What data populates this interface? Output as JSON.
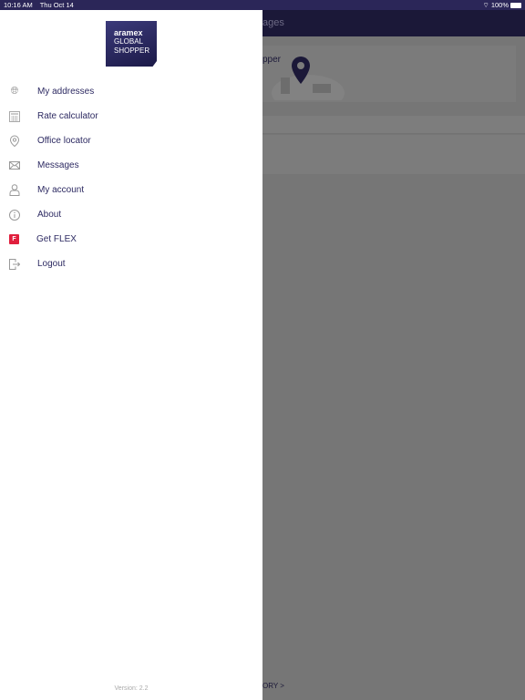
{
  "status_bar": {
    "time": "10:16 AM",
    "date": "Thu Oct 14",
    "battery": "100%"
  },
  "background": {
    "header_title_fragment": "ages",
    "card_text_fragment": "pper",
    "footer_link_fragment": "ORY >"
  },
  "logo": {
    "line1": "aramex",
    "line2": "GLOBAL",
    "line3": "SHOPPER"
  },
  "menu": [
    {
      "label": "My addresses",
      "icon": "globe-icon"
    },
    {
      "label": "Rate calculator",
      "icon": "calculator-icon"
    },
    {
      "label": "Office locator",
      "icon": "location-pin-icon"
    },
    {
      "label": "Messages",
      "icon": "envelope-icon"
    },
    {
      "label": "My account",
      "icon": "user-icon"
    },
    {
      "label": "About",
      "icon": "info-icon"
    },
    {
      "label": "Get FLEX",
      "icon": "flex-icon",
      "icon_text": "F",
      "icon_color": "#e01f3d"
    },
    {
      "label": "Logout",
      "icon": "logout-icon"
    }
  ],
  "version": "Version: 2.2"
}
